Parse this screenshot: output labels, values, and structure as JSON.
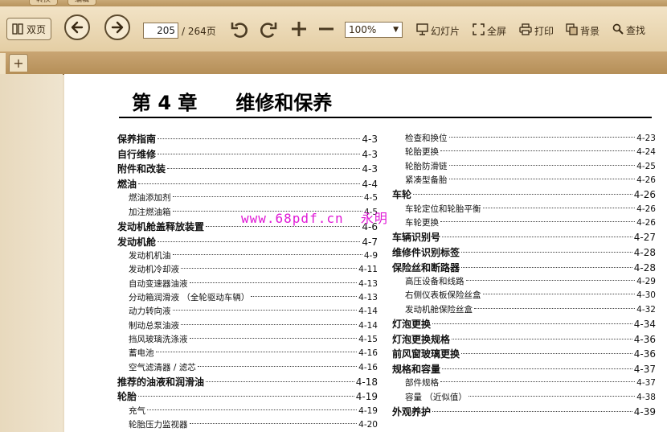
{
  "tabs_top": [
    "转换",
    "编辑"
  ],
  "toolbar": {
    "double_page": "双页",
    "page_current": "205",
    "page_total": "/ 264页",
    "zoom": "100%",
    "slideshow": "幻灯片",
    "fullscreen": "全屏",
    "print": "打印",
    "background": "背景",
    "find": "查找"
  },
  "tabstrip": {
    "add_label": "+"
  },
  "document": {
    "chapter_title": "第 4 章　　维修和保养",
    "watermark": "www.68pdf.cn  永明  ",
    "toc_left": [
      {
        "label": "保养指南",
        "page": "4-3",
        "level": 1
      },
      {
        "label": "自行维修",
        "page": "4-3",
        "level": 1
      },
      {
        "label": "附件和改装",
        "page": "4-3",
        "level": 1
      },
      {
        "label": "燃油",
        "page": "4-4",
        "level": 1
      },
      {
        "label": "燃油添加剂",
        "page": "4-5",
        "level": 2
      },
      {
        "label": "加注燃油箱",
        "page": "4-5",
        "level": 2
      },
      {
        "label": "发动机舱盖释放装置",
        "page": "4-6",
        "level": 1
      },
      {
        "label": "发动机舱",
        "page": "4-7",
        "level": 1
      },
      {
        "label": "发动机机油",
        "page": "4-9",
        "level": 2
      },
      {
        "label": "发动机冷却液",
        "page": "4-11",
        "level": 2
      },
      {
        "label": "自动变速器油液",
        "page": "4-13",
        "level": 2
      },
      {
        "label": "分动箱润滑液 （全轮驱动车辆）",
        "page": "4-13",
        "level": 2
      },
      {
        "label": "动力转向液",
        "page": "4-14",
        "level": 2
      },
      {
        "label": "制动总泵油液",
        "page": "4-14",
        "level": 2
      },
      {
        "label": "挡风玻璃洗涤液",
        "page": "4-15",
        "level": 2
      },
      {
        "label": "蓄电池",
        "page": "4-16",
        "level": 2
      },
      {
        "label": "空气滤清器 / 滤芯",
        "page": "4-16",
        "level": 2
      },
      {
        "label": "推荐的油液和润滑油",
        "page": "4-18",
        "level": 1
      },
      {
        "label": "轮胎",
        "page": "4-19",
        "level": 1
      },
      {
        "label": "充气",
        "page": "4-19",
        "level": 2
      },
      {
        "label": "轮胎压力监视器",
        "page": "4-20",
        "level": 2
      }
    ],
    "toc_right": [
      {
        "label": "检查和换位",
        "page": "4-23",
        "level": 2
      },
      {
        "label": "轮胎更换",
        "page": "4-24",
        "level": 2
      },
      {
        "label": "轮胎防滑链",
        "page": "4-25",
        "level": 2
      },
      {
        "label": "紧凑型备胎",
        "page": "4-26",
        "level": 2
      },
      {
        "label": "车轮",
        "page": "4-26",
        "level": 1
      },
      {
        "label": "车轮定位和轮胎平衡",
        "page": "4-26",
        "level": 2
      },
      {
        "label": "车轮更换",
        "page": "4-26",
        "level": 2
      },
      {
        "label": "车辆识别号",
        "page": "4-27",
        "level": 1
      },
      {
        "label": "维修件识别标签",
        "page": "4-28",
        "level": 1
      },
      {
        "label": "保险丝和断路器",
        "page": "4-28",
        "level": 1
      },
      {
        "label": "高压设备和线路",
        "page": "4-29",
        "level": 2
      },
      {
        "label": "右侧仪表板保险丝盒",
        "page": "4-30",
        "level": 2
      },
      {
        "label": "发动机舱保险丝盒",
        "page": "4-32",
        "level": 2
      },
      {
        "label": "灯泡更换",
        "page": "4-34",
        "level": 1
      },
      {
        "label": "灯泡更换规格",
        "page": "4-36",
        "level": 1
      },
      {
        "label": "前风窗玻璃更换",
        "page": "4-36",
        "level": 1
      },
      {
        "label": "规格和容量",
        "page": "4-37",
        "level": 1
      },
      {
        "label": "部件规格",
        "page": "4-37",
        "level": 2
      },
      {
        "label": "容量 （近似值）",
        "page": "4-38",
        "level": 2
      },
      {
        "label": "外观养护",
        "page": "4-39",
        "level": 1
      }
    ]
  }
}
